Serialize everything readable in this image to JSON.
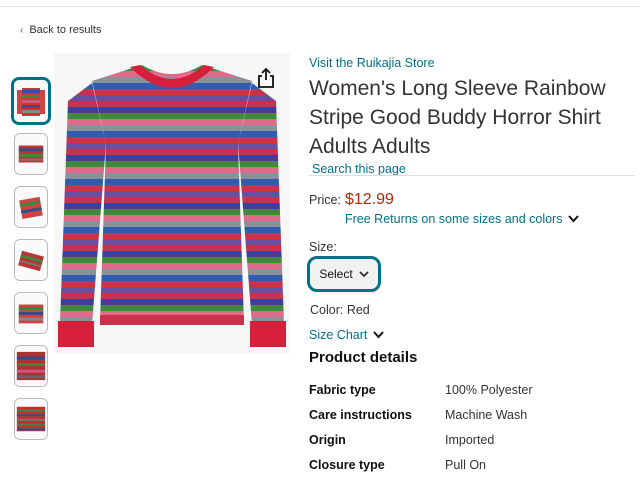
{
  "nav": {
    "back_label": "Back to results"
  },
  "product": {
    "store_link": "Visit the Ruikajia Store",
    "title": "Women's Long Sleeve Rainbow Stripe Good Buddy Horror Shirt Adults Adults",
    "search_link": "Search this page",
    "price_label": "Price:",
    "price": "$12.99",
    "returns_label": "Free Returns on some sizes and colors",
    "size_label": "Size:",
    "size_select": "Select",
    "color_label": "Color: Red",
    "size_chart_label": "Size Chart"
  },
  "details": {
    "heading": "Product details",
    "rows": [
      {
        "key": "Fabric type",
        "value": "100% Polyester"
      },
      {
        "key": "Care instructions",
        "value": "Machine Wash"
      },
      {
        "key": "Origin",
        "value": "Imported"
      },
      {
        "key": "Closure type",
        "value": "Pull On"
      }
    ]
  },
  "colors": {
    "link": "#007185",
    "price": "#b12704",
    "focus": "#007185"
  },
  "icons": {
    "share": "share-icon",
    "chevron": "chevron-down-icon",
    "back": "chevron-left-icon"
  }
}
